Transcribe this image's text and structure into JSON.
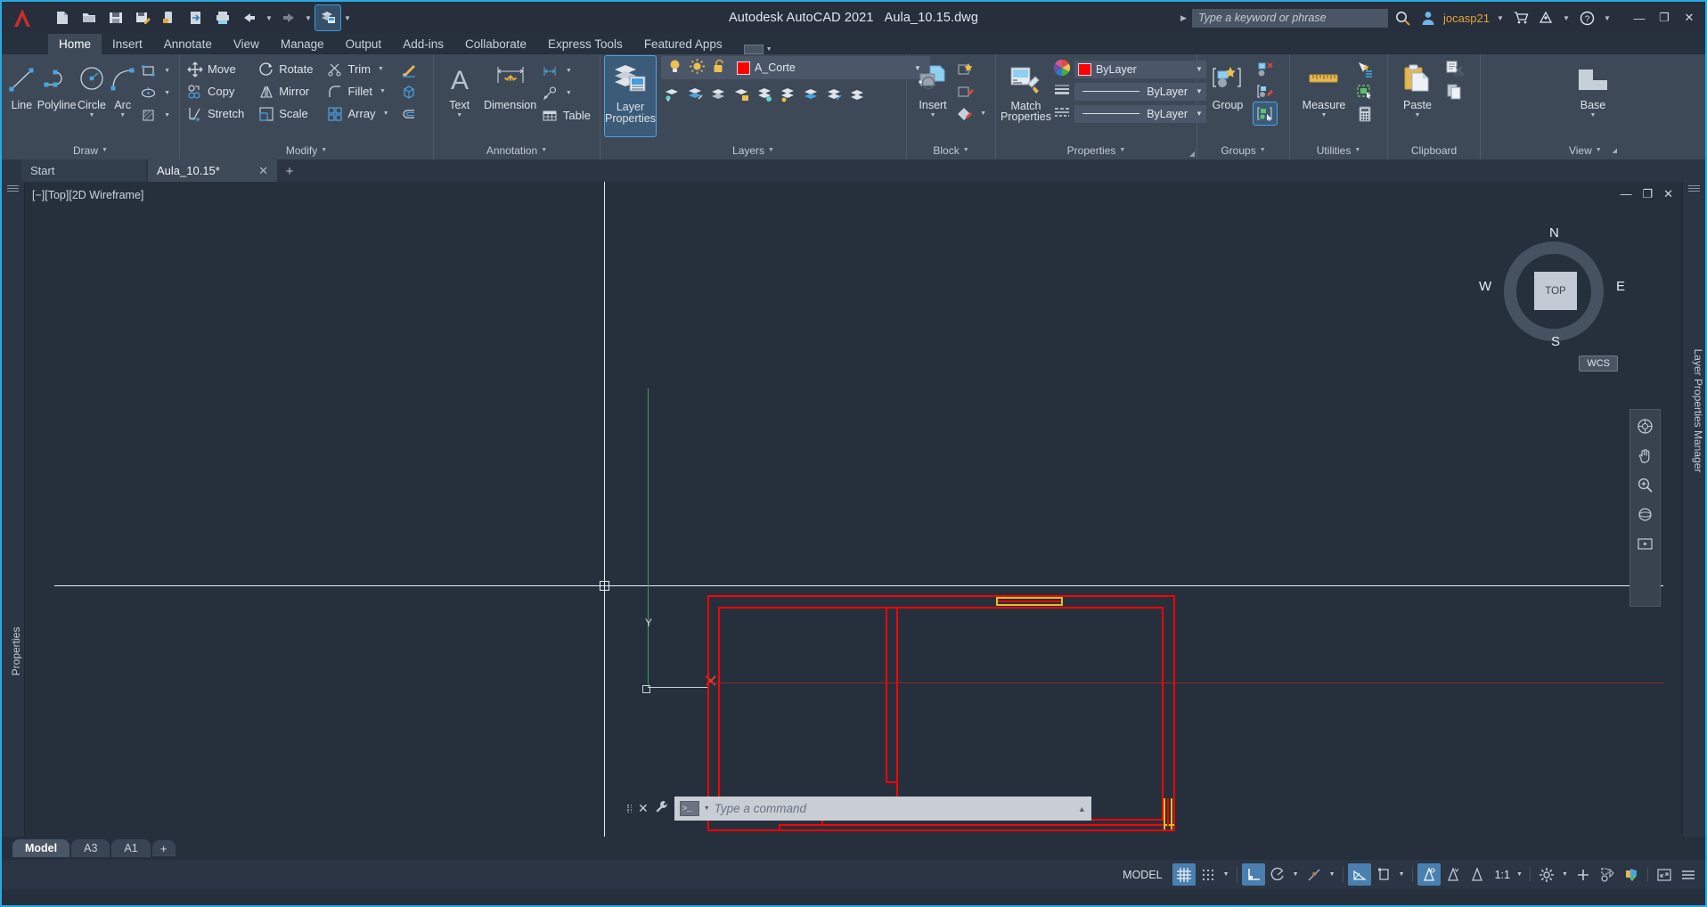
{
  "titlebar": {
    "app_title": "Autodesk AutoCAD 2021",
    "file_title": "Aula_10.15.dwg",
    "search_placeholder": "Type a keyword or phrase",
    "user": "jocasp21",
    "quick_access": [
      "new-icon",
      "open-icon",
      "save-icon",
      "save-as-icon",
      "save-to-web-icon",
      "export-icon",
      "plot-icon",
      "undo-icon",
      "redo-icon",
      "workspace-icon"
    ],
    "window_buttons": [
      "minimize",
      "restore",
      "close"
    ]
  },
  "ribbon": {
    "tabs": [
      "Home",
      "Insert",
      "Annotate",
      "View",
      "Manage",
      "Output",
      "Add-ins",
      "Collaborate",
      "Express Tools",
      "Featured Apps"
    ],
    "active_tab": "Home",
    "panels": {
      "draw": {
        "title": "Draw",
        "line": "Line",
        "polyline": "Polyline",
        "circle": "Circle",
        "arc": "Arc"
      },
      "modify": {
        "title": "Modify",
        "move": "Move",
        "rotate": "Rotate",
        "trim": "Trim",
        "copy": "Copy",
        "mirror": "Mirror",
        "fillet": "Fillet",
        "stretch": "Stretch",
        "scale": "Scale",
        "array": "Array"
      },
      "annotation": {
        "title": "Annotation",
        "text": "Text",
        "dimension": "Dimension",
        "table": "Table"
      },
      "layers": {
        "title": "Layers",
        "layer_properties": "Layer Properties",
        "current_layer": "A_Corte",
        "layer_color": "#ff0000"
      },
      "block": {
        "title": "Block",
        "insert": "Insert"
      },
      "properties": {
        "title": "Properties",
        "match_properties": "Match Properties",
        "color": "ByLayer",
        "linewidth": "ByLayer",
        "linetype": "ByLayer",
        "color_swatch": "#ff0000"
      },
      "groups": {
        "title": "Groups",
        "group": "Group"
      },
      "utilities": {
        "title": "Utilities",
        "measure": "Measure"
      },
      "clipboard": {
        "title": "Clipboard",
        "paste": "Paste"
      },
      "view": {
        "title": "View",
        "base": "Base"
      }
    }
  },
  "file_tabs": {
    "items": [
      {
        "label": "Start",
        "active": false,
        "closable": false
      },
      {
        "label": "Aula_10.15*",
        "active": true,
        "closable": true
      }
    ],
    "add_label": "+"
  },
  "viewport": {
    "label": "[−][Top][2D Wireframe]",
    "ucs_y_label": "Y",
    "viewcube": {
      "top": "TOP",
      "n": "N",
      "s": "S",
      "e": "E",
      "w": "W"
    },
    "wcs": "WCS",
    "left_panel_label": "Properties",
    "right_panel_label": "Layer Properties Manager",
    "controls": [
      "minimize",
      "restore",
      "close"
    ]
  },
  "command_line": {
    "placeholder": "Type a command",
    "value": ""
  },
  "layout_tabs": {
    "items": [
      "Model",
      "A3",
      "A1"
    ],
    "active": "Model",
    "add_label": "+"
  },
  "status_bar": {
    "model_label": "MODEL",
    "scale": "1:1",
    "toggles": [
      {
        "name": "grid-display",
        "on": true
      },
      {
        "name": "snap-mode",
        "on": false
      },
      {
        "name": "ortho-mode",
        "on": true
      },
      {
        "name": "polar-tracking",
        "on": false
      },
      {
        "name": "object-snap",
        "on": false
      },
      {
        "name": "isometric-drafting",
        "on": true
      },
      {
        "name": "object-snap-tracking",
        "on": false
      },
      {
        "name": "annotation-visibility",
        "on": true
      },
      {
        "name": "autoscale",
        "on": false
      },
      {
        "name": "annotation-scale",
        "on": false
      }
    ]
  },
  "colors": {
    "accent": "#2aa9e0",
    "ribbon_bg": "#3e4957",
    "canvas_bg": "#26303d",
    "geometry_red": "#ff0000",
    "geometry_yellow": "#d4c520",
    "ucs_green": "#3ba34a",
    "user_orange": "#e3a33a"
  }
}
